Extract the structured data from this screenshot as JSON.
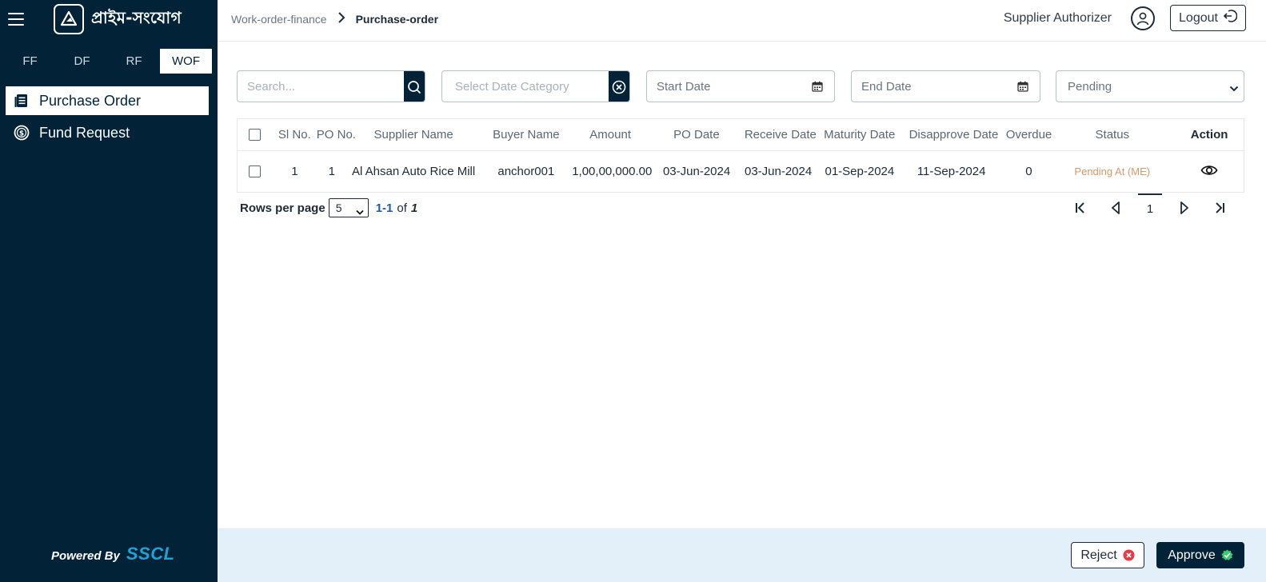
{
  "sidebar": {
    "brand": "প্রাইম-সংযোগ",
    "tabs": [
      "FF",
      "DF",
      "RF",
      "WOF"
    ],
    "active_tab": "WOF",
    "menu": [
      {
        "label": "Purchase Order",
        "icon": "document-list-icon",
        "active": true
      },
      {
        "label": "Fund Request",
        "icon": "dollar-circle-icon",
        "active": false
      }
    ],
    "powered_by": "Powered By",
    "powered_brand": "SSCL"
  },
  "header": {
    "breadcrumb": [
      "Work-order-finance",
      "Purchase-order"
    ],
    "user_role": "Supplier Authorizer",
    "logout_label": "Logout"
  },
  "filters": {
    "search_placeholder": "Search...",
    "date_category_placeholder": "Select Date Category",
    "start_date_placeholder": "Start Date",
    "end_date_placeholder": "End Date",
    "status_value": "Pending"
  },
  "table": {
    "columns": [
      "Sl No.",
      "PO No.",
      "Supplier Name",
      "Buyer Name",
      "Amount",
      "PO Date",
      "Receive Date",
      "Maturity Date",
      "Disapprove Date",
      "Overdue",
      "Status",
      "Action"
    ],
    "rows": [
      {
        "sl": "1",
        "po": "1",
        "supplier": "Al Ahsan Auto Rice Mill",
        "buyer": "anchor001",
        "amount": "1,00,00,000.00",
        "po_date": "03-Jun-2024",
        "receive_date": "03-Jun-2024",
        "maturity_date": "01-Sep-2024",
        "disapprove_date": "11-Sep-2024",
        "overdue": "0",
        "status": "Pending At (ME)"
      }
    ]
  },
  "pagination": {
    "rows_per_page_label": "Rows per page",
    "rows_per_page": "5",
    "range": "1-1",
    "of_label": "of",
    "total": "1",
    "current_page": "1"
  },
  "footer": {
    "reject_label": "Reject",
    "approve_label": "Approve"
  },
  "colors": {
    "sidebar_bg": "#012237",
    "footer_bg": "#e3eff9",
    "status_pending": "#d49a6a",
    "reject_icon": "#e53946",
    "approve_icon": "#3cc96b",
    "brand_accent": "#1fa3d6"
  }
}
